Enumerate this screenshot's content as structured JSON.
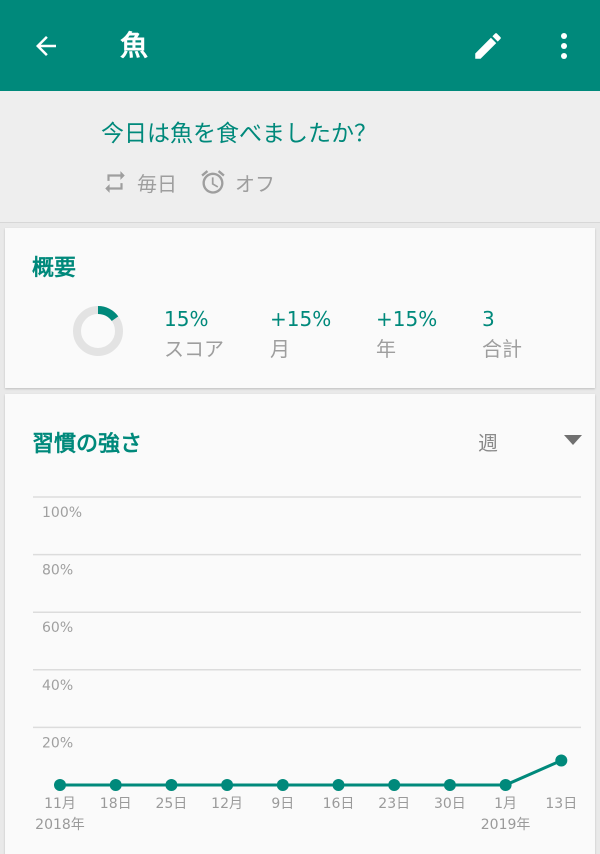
{
  "app_bar": {
    "title": "魚",
    "back_icon": "arrow-back-icon",
    "edit_icon": "pencil-icon",
    "more_icon": "more-vert-icon",
    "color": "#00897b"
  },
  "habit": {
    "question": "今日は魚を食べましたか？",
    "frequency": "毎日",
    "reminder": "オフ"
  },
  "overview": {
    "heading": "概要",
    "score_fraction": 0.15,
    "stats": [
      {
        "value": "15%",
        "label": "スコア"
      },
      {
        "value": "+15%",
        "label": "月"
      },
      {
        "value": "+15%",
        "label": "年"
      },
      {
        "value": "3",
        "label": "合計"
      }
    ]
  },
  "strength": {
    "heading": "習慣の強さ",
    "period": "週",
    "period_dropdown_icon": "triangle-down-icon"
  },
  "chart_data": {
    "type": "line",
    "y_ticks": [
      "100%",
      "80%",
      "60%",
      "40%",
      "20%"
    ],
    "ylim": [
      0,
      100
    ],
    "x_labels": [
      {
        "day": "11月",
        "year": "2018年"
      },
      {
        "day": "18日",
        "year": ""
      },
      {
        "day": "25日",
        "year": ""
      },
      {
        "day": "12月",
        "year": ""
      },
      {
        "day": "9日",
        "year": ""
      },
      {
        "day": "16日",
        "year": ""
      },
      {
        "day": "23日",
        "year": ""
      },
      {
        "day": "30日",
        "year": ""
      },
      {
        "day": "1月",
        "year": "2019年"
      },
      {
        "day": "13日",
        "year": ""
      }
    ],
    "values": [
      0,
      0,
      0,
      0,
      0,
      0,
      0,
      0,
      0,
      8.5
    ],
    "color": "#00897b",
    "grid": true
  }
}
